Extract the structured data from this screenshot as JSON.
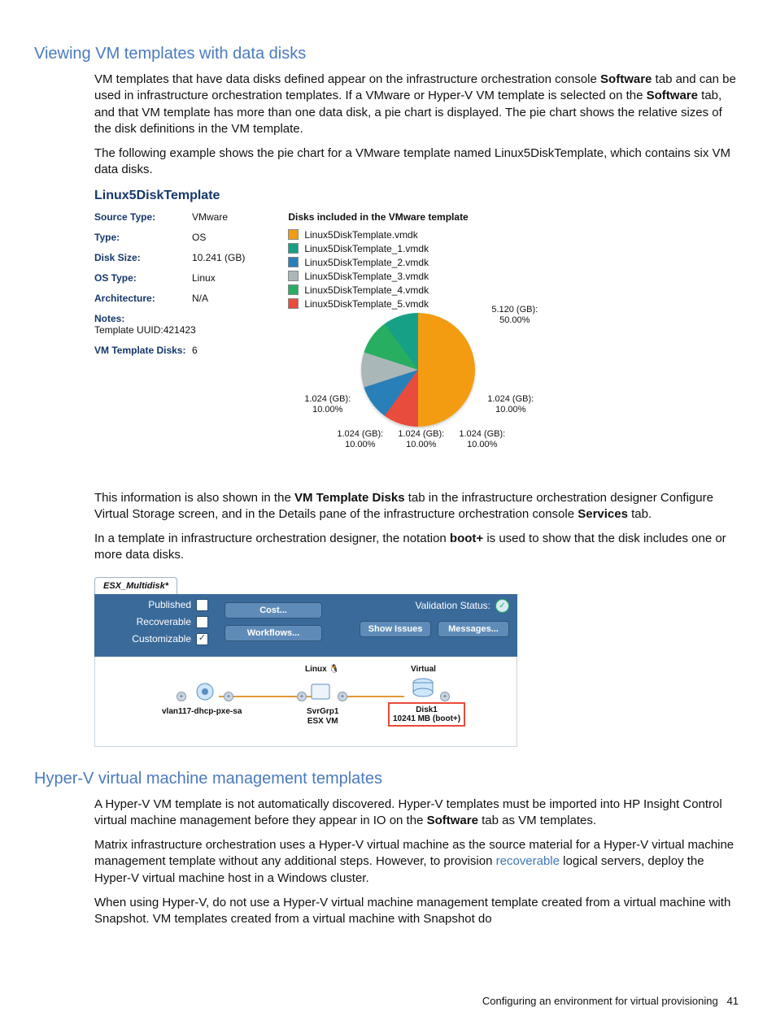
{
  "headings": {
    "h1": "Viewing VM templates with data disks",
    "h2": "Hyper-V virtual machine management templates"
  },
  "paragraphs": {
    "p1a": "VM templates that have data disks defined appear on the infrastructure orchestration console ",
    "p1b": " tab and can be used in infrastructure orchestration templates. If a VMware or Hyper-V VM template is selected on the ",
    "p1c": " tab, and that VM template has more than one data disk, a pie chart is displayed. The pie chart shows the relative sizes of the disk definitions in the VM template.",
    "p2": "The following example shows the pie chart for a VMware template named Linux5DiskTemplate, which contains six VM data disks.",
    "p3a": "This information is also shown in the ",
    "p3b": " tab in the infrastructure orchestration designer Configure Virtual Storage screen, and in the Details pane of the infrastructure orchestration console ",
    "p3c": " tab.",
    "p4a": "In a template in infrastructure orchestration designer, the notation ",
    "p4b": " is used to show that the disk includes one or more data disks.",
    "p5a": "A Hyper-V VM template is not automatically discovered. Hyper-V templates must be imported into HP Insight Control virtual machine management before they appear in IO on the ",
    "p5b": " tab as VM templates.",
    "p6a": "Matrix infrastructure orchestration uses a Hyper-V virtual machine as the source material for a Hyper-V virtual machine management template without any additional steps. However, to provision ",
    "p6b": " logical servers, deploy the Hyper-V virtual machine host in a Windows cluster.",
    "p7": "When using Hyper-V, do not use a Hyper-V virtual machine management template created from a virtual machine with Snapshot. VM templates created from a virtual machine with Snapshot do"
  },
  "bold": {
    "software": "Software",
    "vm_template_disks": "VM Template Disks",
    "services": "Services",
    "bootplus": "boot+"
  },
  "link_recoverable": "recoverable",
  "chart_data": {
    "type": "pie",
    "title": "Disks included in the VMware template",
    "template_name": "Linux5DiskTemplate",
    "properties": {
      "Source Type:": "VMware",
      "Type:": "OS",
      "Disk Size:": "10.241 (GB)",
      "OS Type:": "Linux",
      "Architecture:": "N/A",
      "Notes:": "Template UUID:421423",
      "VM Template Disks:": "6"
    },
    "legend": [
      {
        "name": "Linux5DiskTemplate.vmdk",
        "color": "#f39c12"
      },
      {
        "name": "Linux5DiskTemplate_1.vmdk",
        "color": "#16a085"
      },
      {
        "name": "Linux5DiskTemplate_2.vmdk",
        "color": "#2980b9"
      },
      {
        "name": "Linux5DiskTemplate_3.vmdk",
        "color": "#aab7b8"
      },
      {
        "name": "Linux5DiskTemplate_4.vmdk",
        "color": "#27ae60"
      },
      {
        "name": "Linux5DiskTemplate_5.vmdk",
        "color": "#e74c3c"
      }
    ],
    "slices": [
      {
        "disk": "Linux5DiskTemplate.vmdk",
        "size_gb": 5.12,
        "percent": 50.0
      },
      {
        "disk": "Linux5DiskTemplate_1.vmdk",
        "size_gb": 1.024,
        "percent": 10.0
      },
      {
        "disk": "Linux5DiskTemplate_2.vmdk",
        "size_gb": 1.024,
        "percent": 10.0
      },
      {
        "disk": "Linux5DiskTemplate_3.vmdk",
        "size_gb": 1.024,
        "percent": 10.0
      },
      {
        "disk": "Linux5DiskTemplate_4.vmdk",
        "size_gb": 1.024,
        "percent": 10.0
      },
      {
        "disk": "Linux5DiskTemplate_5.vmdk",
        "size_gb": 1.024,
        "percent": 10.0
      }
    ],
    "slice_labels": {
      "big": "5.120 (GB):\n50.00%",
      "s1": "1.024 (GB):\n10.00%",
      "s2": "1.024 (GB):\n10.00%",
      "s3": "1.024 (GB):\n10.00%",
      "s4": "1.024 (GB):\n10.00%",
      "s5": "1.024 (GB):\n10.00%"
    }
  },
  "fig2": {
    "tab": "ESX_Multidisk*",
    "flags": {
      "published": "Published",
      "recoverable": "Recoverable",
      "customizable": "Customizable"
    },
    "buttons": {
      "cost": "Cost...",
      "workflows": "Workflows...",
      "show_issues": "Show Issues",
      "messages": "Messages..."
    },
    "validation_label": "Validation Status:",
    "nodes": {
      "net": "vlan117-dhcp-pxe-sa",
      "vm_top": "Linux",
      "vm1": "SvrGrp1",
      "vm2": "ESX VM",
      "virt": "Virtual",
      "disk1": "Disk1",
      "disk2": "10241 MB (boot+)"
    }
  },
  "footer": {
    "text": "Configuring an environment for virtual provisioning",
    "page": "41"
  }
}
